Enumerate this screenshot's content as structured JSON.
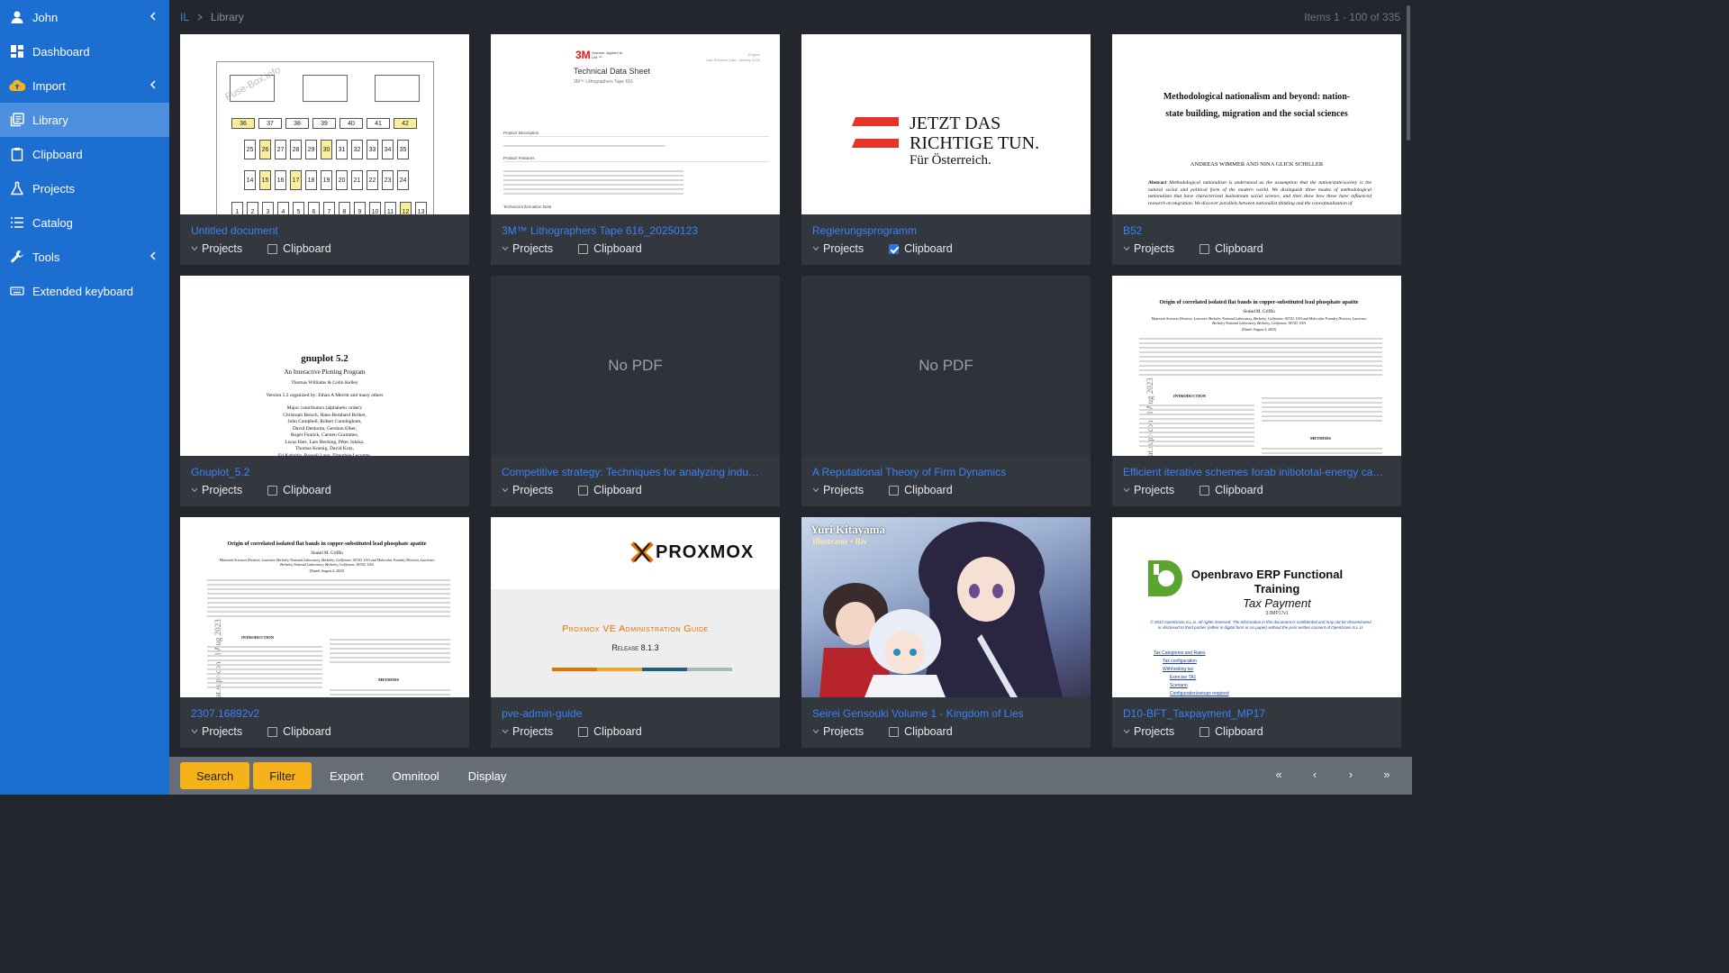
{
  "sidebar": {
    "user": "John",
    "items": [
      {
        "label": "Dashboard"
      },
      {
        "label": "Import"
      },
      {
        "label": "Library"
      },
      {
        "label": "Clipboard"
      },
      {
        "label": "Projects"
      },
      {
        "label": "Catalog"
      },
      {
        "label": "Tools"
      },
      {
        "label": "Extended keyboard"
      }
    ]
  },
  "header": {
    "crumb_root": "IL",
    "crumb_current": "Library",
    "items_count": "Items 1 - 100 of 335"
  },
  "cards": [
    {
      "title": "Untitled document",
      "projects": "Projects",
      "clipboard": "Clipboard",
      "checked": false
    },
    {
      "title": "3M™ Lithographers Tape 616_20250123",
      "projects": "Projects",
      "clipboard": "Clipboard",
      "checked": false
    },
    {
      "title": "Regierungsprogramm",
      "projects": "Projects",
      "clipboard": "Clipboard",
      "checked": true
    },
    {
      "title": "B52",
      "projects": "Projects",
      "clipboard": "Clipboard",
      "checked": false
    },
    {
      "title": "Gnuplot_5.2",
      "projects": "Projects",
      "clipboard": "Clipboard",
      "checked": false
    },
    {
      "title": "Competitive strategy: Techniques for analyzing indu…",
      "projects": "Projects",
      "clipboard": "Clipboard",
      "checked": false,
      "nopdf": "No PDF"
    },
    {
      "title": "A Reputational Theory of Firm Dynamics",
      "projects": "Projects",
      "clipboard": "Clipboard",
      "checked": false,
      "nopdf": "No PDF"
    },
    {
      "title": "Efficient iterative schemes forab initiototal-energy ca…",
      "projects": "Projects",
      "clipboard": "Clipboard",
      "checked": false
    },
    {
      "title": "2307.16892v2",
      "projects": "Projects",
      "clipboard": "Clipboard",
      "checked": false
    },
    {
      "title": "pve-admin-guide",
      "projects": "Projects",
      "clipboard": "Clipboard",
      "checked": false
    },
    {
      "title": "Seirei Gensouki Volume 1 - Kingdom of Lies",
      "projects": "Projects",
      "clipboard": "Clipboard",
      "checked": false
    },
    {
      "title": "D10-BFT_Taxpayment_MP17",
      "projects": "Projects",
      "clipboard": "Clipboard",
      "checked": false
    }
  ],
  "thumbs": {
    "fuse": {
      "watermark": "Fuse-Box.info",
      "row1": [
        "36",
        "37",
        "38",
        "39",
        "40",
        "41",
        "42"
      ],
      "row2": [
        "25",
        "26",
        "27",
        "28",
        "29",
        "30",
        "31",
        "32",
        "33",
        "34",
        "35"
      ],
      "row3": [
        "14",
        "15",
        "16",
        "17",
        "18",
        "19",
        "20",
        "21",
        "22",
        "23",
        "24"
      ],
      "row4": [
        "1",
        "2",
        "3",
        "4",
        "5",
        "6",
        "7",
        "8",
        "9",
        "10",
        "11",
        "12",
        "13"
      ]
    },
    "tape": {
      "brand": "3M",
      "brand_sub": "Science. Applied to Life.™",
      "title": "Technical Data Sheet",
      "subtitle": "3M™ Lithographers Tape 616",
      "lang": "English",
      "date": "Last Revision Date: January 2025",
      "s1": "Product Description",
      "s2": "Product Features",
      "s3": "Technical Information Note"
    },
    "regierung": {
      "line1": "JETZT DAS",
      "line2": "RICHTIGE TUN.",
      "line3": "Für Österreich."
    },
    "b52": {
      "title": "Methodological nationalism and beyond: nation-state building, migration and the social sciences",
      "authors": "ANDREAS WIMMER AND NINA GLICK SCHILLER",
      "abstract_label": "Abstract",
      "abstract": "Methodological nationalism is understood as the assumption that the nation/state/society is the natural social and political form of the modern world. We distinguish three modes of methodological nationalism that have characterized mainstream social science, and then show how these have influenced research on migration. We discover parallels between nationalist thinking and the conceptualization of"
    },
    "gnuplot": {
      "title": "gnuplot 5.2",
      "subtitle": "An Interactive Plotting Program",
      "authors": "Thomas Williams & Colin Kelley",
      "organized": "Version 5.2 organized by: Ethan A Merritt and many others",
      "contributors": [
        "Major contributors (alphabetic order):",
        "Christoph Bersch, Hans-Bernhard Bröker,",
        "John Campbell, Robert Cunningham,",
        "David Denholm, Gershon Elber,",
        "Roger Fearick, Carsten Grammes,",
        "Lucas Hart, Lars Hecking, Péter Juhász,",
        "Thomas Koenig, David Kotz,",
        "Ed Kubaitis, Russell Lang, Timothée Lecomte,"
      ]
    },
    "paper": {
      "title": "Origin of correlated isolated flat bands in copper-substituted lead phosphate apatite",
      "author": "Sinéad M. Griffin",
      "affil": "Materials Sciences Division, Lawrence Berkeley National Laboratory, Berkeley, California, 94720, USA and Molecular Foundry Division, Lawrence Berkeley National Laboratory, Berkeley, California, 94720, USA",
      "date": "(Dated: August 4, 2023)",
      "arxiv": "nat.supr-con]   3 Aug 2023",
      "intro": "INTRODUCTION",
      "methods": "METHODS"
    },
    "proxmox": {
      "logo": "PROXMOX",
      "guide": "Proxmox VE Administration Guide",
      "release": "Release 8.1.3"
    },
    "seirei": {
      "credit": "Illustrator • Riv",
      "author": "Yuri Kitayama"
    },
    "openbravo": {
      "title1": "Openbravo ERP Functional",
      "title2": "Training",
      "subtitle": "Tax Payment",
      "version": "3.0MP17v1",
      "copyright": "© 2012 Openbravo S.L.U. All rights reserved. The information in this document is confidential and may not be disseminated or disclosed to third parties (either in digital form or on paper) without the prior written consent of Openbravo S.L.U.",
      "links": [
        "Tax Categories and Rates",
        "Tax configuration",
        "Withholding tax",
        "Exercise TA1",
        "Scenario",
        "Configuration/setups required"
      ]
    }
  },
  "bottombar": {
    "search": "Search",
    "filter": "Filter",
    "export": "Export",
    "omnitool": "Omnitool",
    "display": "Display",
    "first": "«",
    "prev": "‹",
    "next": "›",
    "last": "»"
  },
  "colors": {
    "sidebar": "#1c6fd1",
    "sidebar_active": "#4d8fdf",
    "accent_yellow": "#f5b21a",
    "link": "#3b82f6",
    "bg": "#23262c",
    "card": "#33373e",
    "bottombar": "#676d77"
  }
}
